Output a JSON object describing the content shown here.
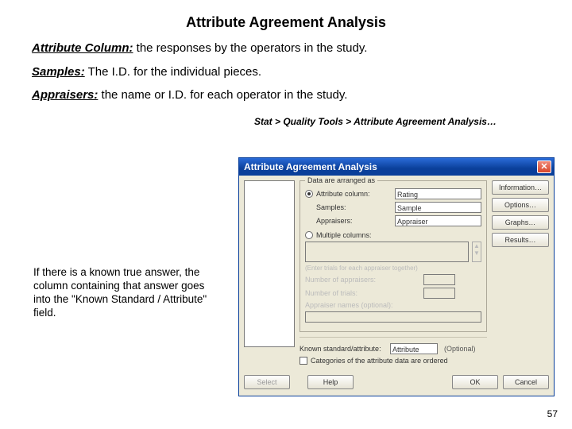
{
  "title": "Attribute Agreement Analysis",
  "defs": {
    "attr_term": "Attribute Column:",
    "attr_text": " the responses by the operators in the study.",
    "samp_term": "Samples:",
    "samp_text": " The I.D. for the individual pieces.",
    "appr_term": "Appraisers:",
    "appr_text": " the name or I.D. for each operator in the study."
  },
  "menu_path": "Stat > Quality Tools > Attribute Agreement Analysis…",
  "note": "If there is a known true answer, the column containing that answer goes into the \"Known Standard / Attribute\" field.",
  "pagenum": "57",
  "dlg": {
    "title": "Attribute Agreement Analysis",
    "close": "✕",
    "group_title": "Data are arranged as",
    "radio_attr": "Attribute column:",
    "field_attr": "Rating",
    "lbl_samples": "Samples:",
    "field_samples": "Sample",
    "lbl_appr": "Appraisers:",
    "field_appr": "Appraiser",
    "radio_mult": "Multiple columns:",
    "hint_trials": "(Enter trials for each appraiser together)",
    "lbl_numappr": "Number of appraisers:",
    "lbl_numtrials": "Number of trials:",
    "lbl_apprnames": "Appraiser names (optional):",
    "lbl_known": "Known standard/attribute:",
    "field_known": "Attribute",
    "optional": "(Optional)",
    "chk_cat": "Categories of the attribute data are ordered",
    "btn_info": "Information…",
    "btn_opts": "Options…",
    "btn_graphs": "Graphs…",
    "btn_results": "Results…",
    "btn_select": "Select",
    "btn_help": "Help",
    "btn_ok": "OK",
    "btn_cancel": "Cancel"
  }
}
